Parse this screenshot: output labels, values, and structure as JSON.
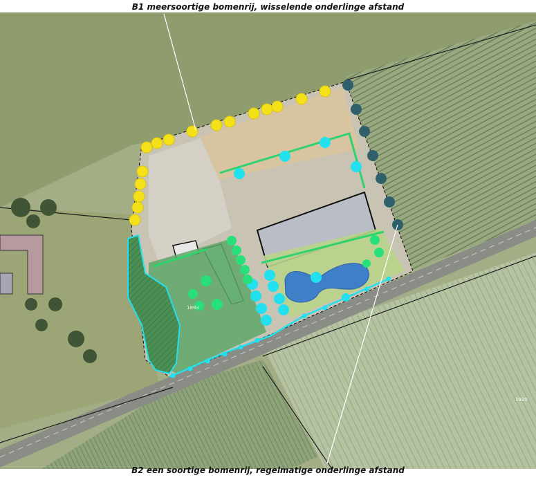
{
  "labels": {
    "top": "B1 meersoortige bomenrij, wisselende onderlinge afstand",
    "bottom": "B2 een soortige bomenrij, regelmatige onderlinge afstand",
    "parcel_number": "1893",
    "field_number": "1925"
  },
  "colors": {
    "tree_row_b1": "#f5e11a",
    "tree_row_b2": "#2e5f6b",
    "tree_cyan": "#22e0ee",
    "tree_green": "#27e07a",
    "hedge_line": "#2fd36b",
    "pond": "#3f7fc8"
  }
}
